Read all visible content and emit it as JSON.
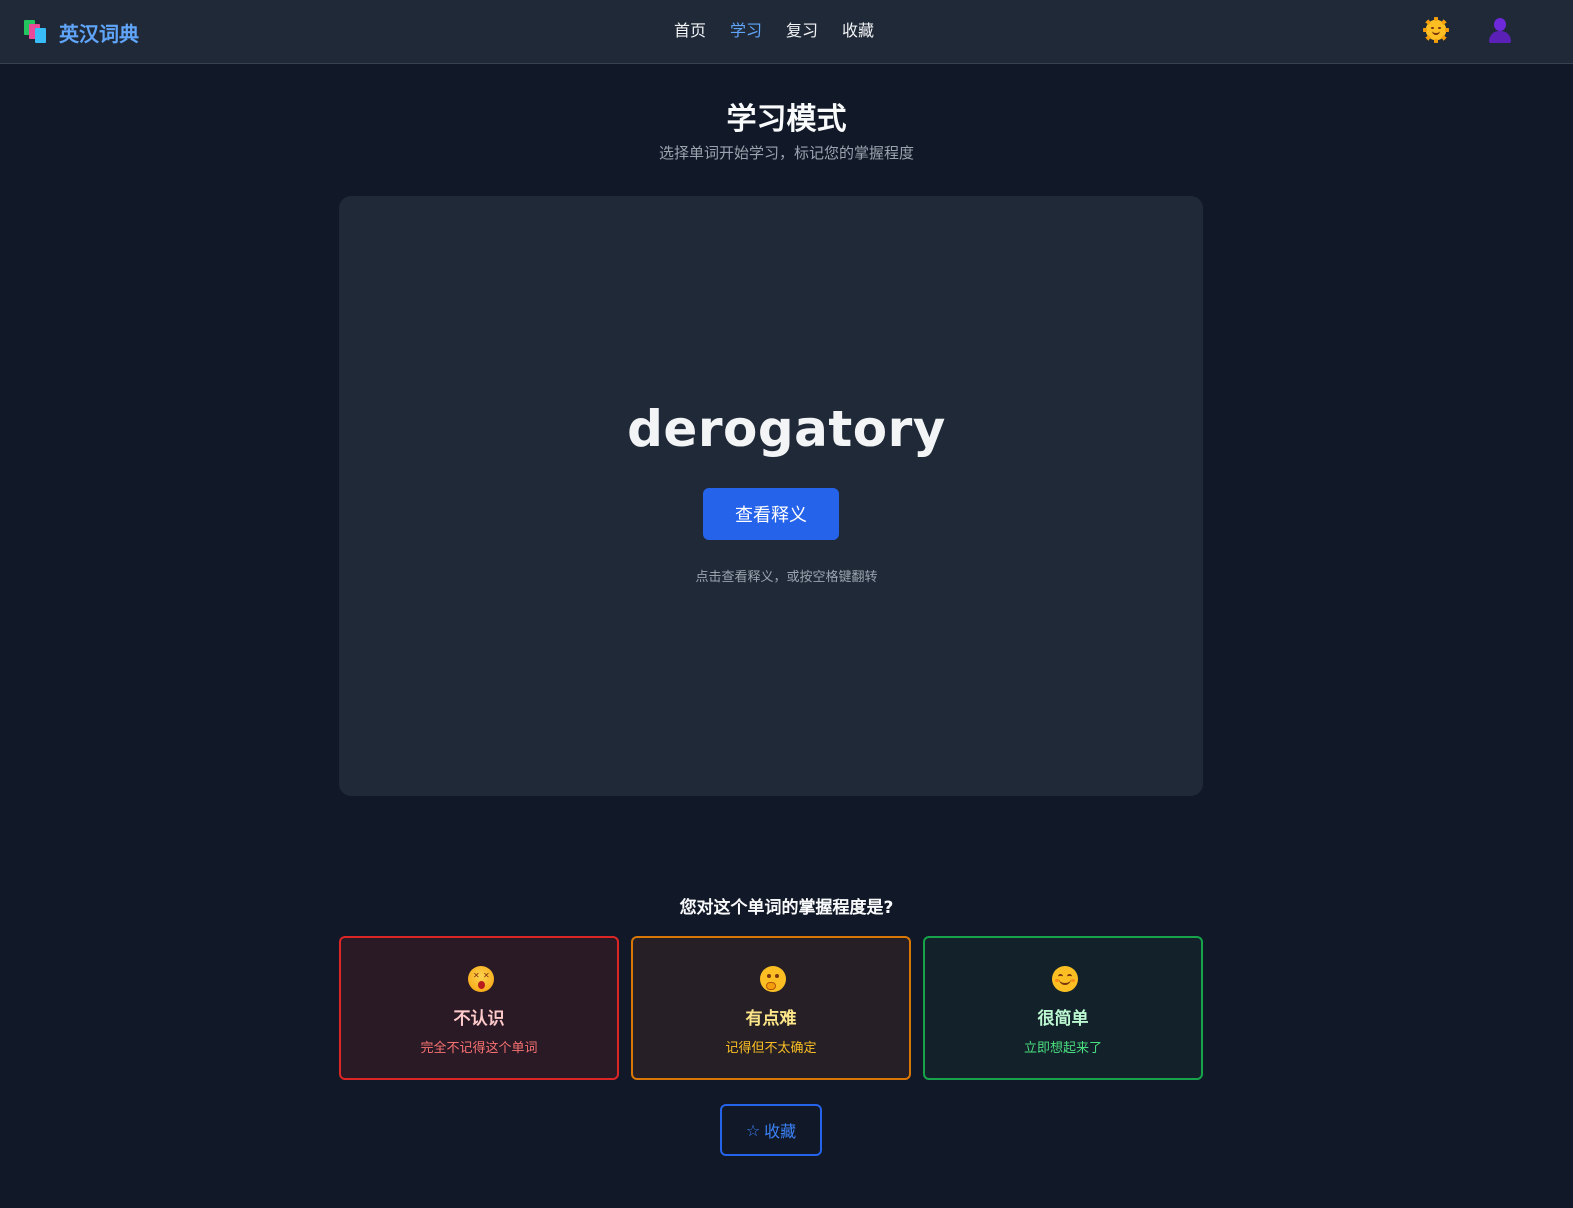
{
  "header": {
    "app_title": "英汉词典",
    "nav": [
      {
        "label": "首页",
        "active": false
      },
      {
        "label": "学习",
        "active": true
      },
      {
        "label": "复习",
        "active": false
      },
      {
        "label": "收藏",
        "active": false
      }
    ],
    "theme_icon": "sun-face-icon",
    "user_icon": "user-silhouette-icon"
  },
  "page": {
    "title": "学习模式",
    "subtitle": "选择单词开始学习，标记您的掌握程度"
  },
  "flashcard": {
    "word": "derogatory",
    "reveal_label": "查看释义",
    "hint": "点击查看释义，或按空格键翻转"
  },
  "mastery": {
    "question": "您对这个单词的掌握程度是?",
    "levels": [
      {
        "title": "不认识",
        "desc": "完全不记得这个单词",
        "icon": "dizzy-face-icon",
        "color": "#dc2626"
      },
      {
        "title": "有点难",
        "desc": "记得但不太确定",
        "icon": "thinking-face-icon",
        "color": "#d97706"
      },
      {
        "title": "很简单",
        "desc": "立即想起来了",
        "icon": "smiling-face-icon",
        "color": "#16a34a"
      }
    ]
  },
  "favorite": {
    "star": "☆",
    "label": "收藏"
  },
  "colors": {
    "accent": "#2563eb",
    "background": "#111827",
    "card": "#1f2937"
  }
}
